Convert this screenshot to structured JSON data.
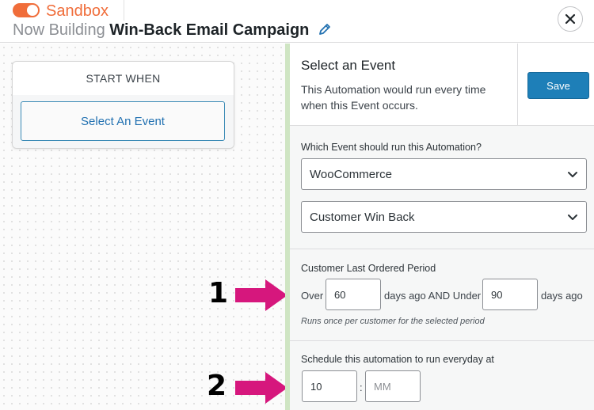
{
  "header": {
    "mode_label": "Sandbox",
    "title_prefix": "Now Building",
    "automation_name": "Win-Back Email Campaign"
  },
  "canvas": {
    "start_card_title": "START WHEN",
    "select_event_button": "Select An Event"
  },
  "annotations": {
    "step1": "1",
    "step2": "2",
    "arrow_color": "#d6177d"
  },
  "panel": {
    "title": "Select an Event",
    "description": "This Automation would run every time when this Event occurs.",
    "save_label": "Save",
    "event_question": "Which Event should run this Automation?",
    "integration_value": "WooCommerce",
    "event_value": "Customer Win Back",
    "period_label": "Customer Last Ordered Period",
    "over_text": "Over",
    "over_value": "60",
    "between_text": "days ago AND Under",
    "under_value": "90",
    "days_ago_text": "days ago",
    "period_hint": "Runs once per customer for the selected period",
    "schedule_label": "Schedule this automation to run everyday at",
    "hour_value": "10",
    "time_separator": ":",
    "minute_placeholder": "MM"
  },
  "colors": {
    "brand_orange": "#f06d3a",
    "primary_blue": "#1e7fb8",
    "divider_green": "#cfe5c3"
  }
}
